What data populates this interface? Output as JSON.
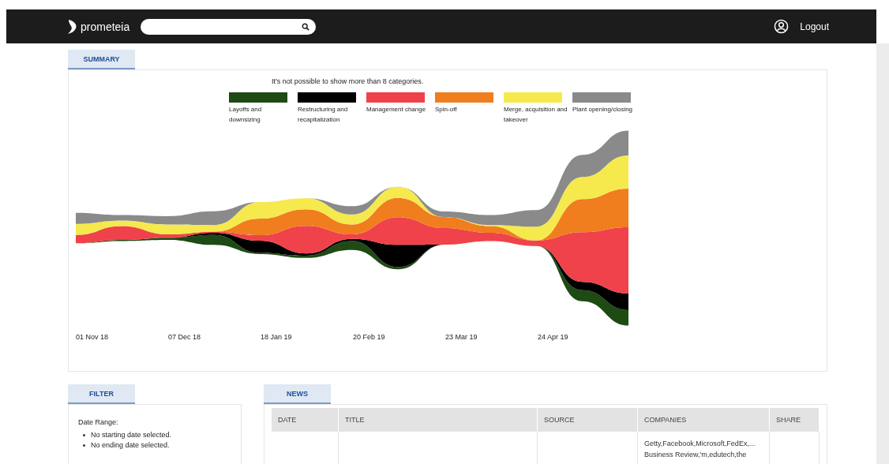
{
  "header": {
    "logo": "prometeia",
    "logout": "Logout"
  },
  "summary": {
    "tab": "SUMMARY",
    "notice": "It's not possible to show more than 8 categories.",
    "legend": [
      {
        "label": "Layoffs and downsizing",
        "color": "#1e4a14"
      },
      {
        "label": "Restructuring and recapitalization",
        "color": "#000000"
      },
      {
        "label": "Management change",
        "color": "#f0424a"
      },
      {
        "label": "Spin-off",
        "color": "#f07d1e"
      },
      {
        "label": "Merge, acquisition and takeover",
        "color": "#f5e94e"
      },
      {
        "label": "Plant opening/closing",
        "color": "#8a8a8a"
      }
    ],
    "x_labels": [
      "01 Nov 18",
      "07 Dec 18",
      "18 Jan 19",
      "20 Feb 19",
      "23 Mar 19",
      "24 Apr 19"
    ]
  },
  "filter": {
    "tab": "FILTER",
    "label": "Date Range:",
    "items": [
      "No starting date selected.",
      "No ending date selected."
    ]
  },
  "news": {
    "tab": "NEWS",
    "columns": [
      "DATE",
      "TITLE",
      "SOURCE",
      "COMPANIES",
      "SHARE"
    ],
    "rows": [
      {
        "companies": "Getty,Facebook,Microsoft,FedEx,...\nBusiness Review,'m,edutech,the"
      }
    ]
  }
}
